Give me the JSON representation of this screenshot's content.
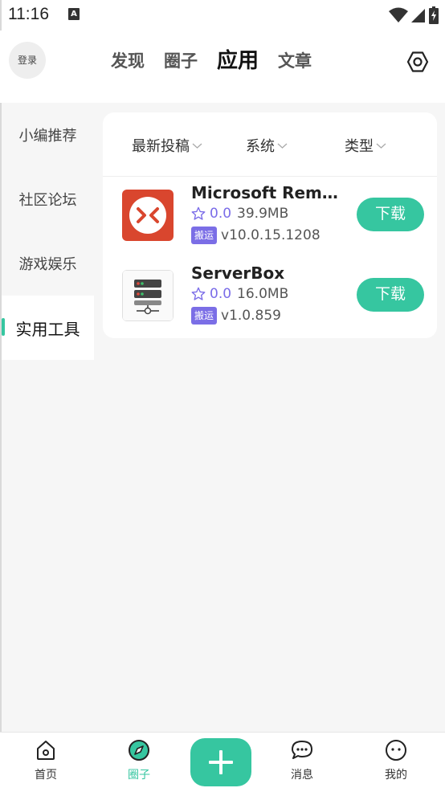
{
  "status": {
    "time": "11:16",
    "notification_icon": "A"
  },
  "header": {
    "login_label": "登录",
    "tabs": [
      {
        "label": "发现"
      },
      {
        "label": "圈子"
      },
      {
        "label": "应用"
      },
      {
        "label": "文章"
      }
    ],
    "active_tab": "应用"
  },
  "sidebar": {
    "items": [
      {
        "label": "小编推荐"
      },
      {
        "label": "社区论坛"
      },
      {
        "label": "游戏娱乐"
      },
      {
        "label": "实用工具"
      }
    ],
    "active_item": "实用工具"
  },
  "filters": [
    {
      "label": "最新投稿"
    },
    {
      "label": "系统"
    },
    {
      "label": "类型"
    }
  ],
  "apps": [
    {
      "name": "Microsoft Remote Desktop",
      "rating": "0.0",
      "size": "39.9MB",
      "tag": "搬运",
      "version": "v10.0.15.1208",
      "download_label": "下载",
      "icon": "remote-desktop-icon"
    },
    {
      "name": "ServerBox",
      "rating": "0.0",
      "size": "16.0MB",
      "tag": "搬运",
      "version": "v1.0.859",
      "download_label": "下载",
      "icon": "server-icon"
    }
  ],
  "bottom_nav": {
    "items": [
      {
        "label": "首页",
        "icon": "home-icon"
      },
      {
        "label": "圈子",
        "icon": "compass-icon"
      },
      {
        "label": "消息",
        "icon": "chat-icon"
      },
      {
        "label": "我的",
        "icon": "face-icon"
      }
    ],
    "active_item": "圈子"
  },
  "colors": {
    "accent": "#36c6a0",
    "tag": "#7b6ee6",
    "rating": "#7a6ce8",
    "app_icon_red": "#d9462e"
  }
}
